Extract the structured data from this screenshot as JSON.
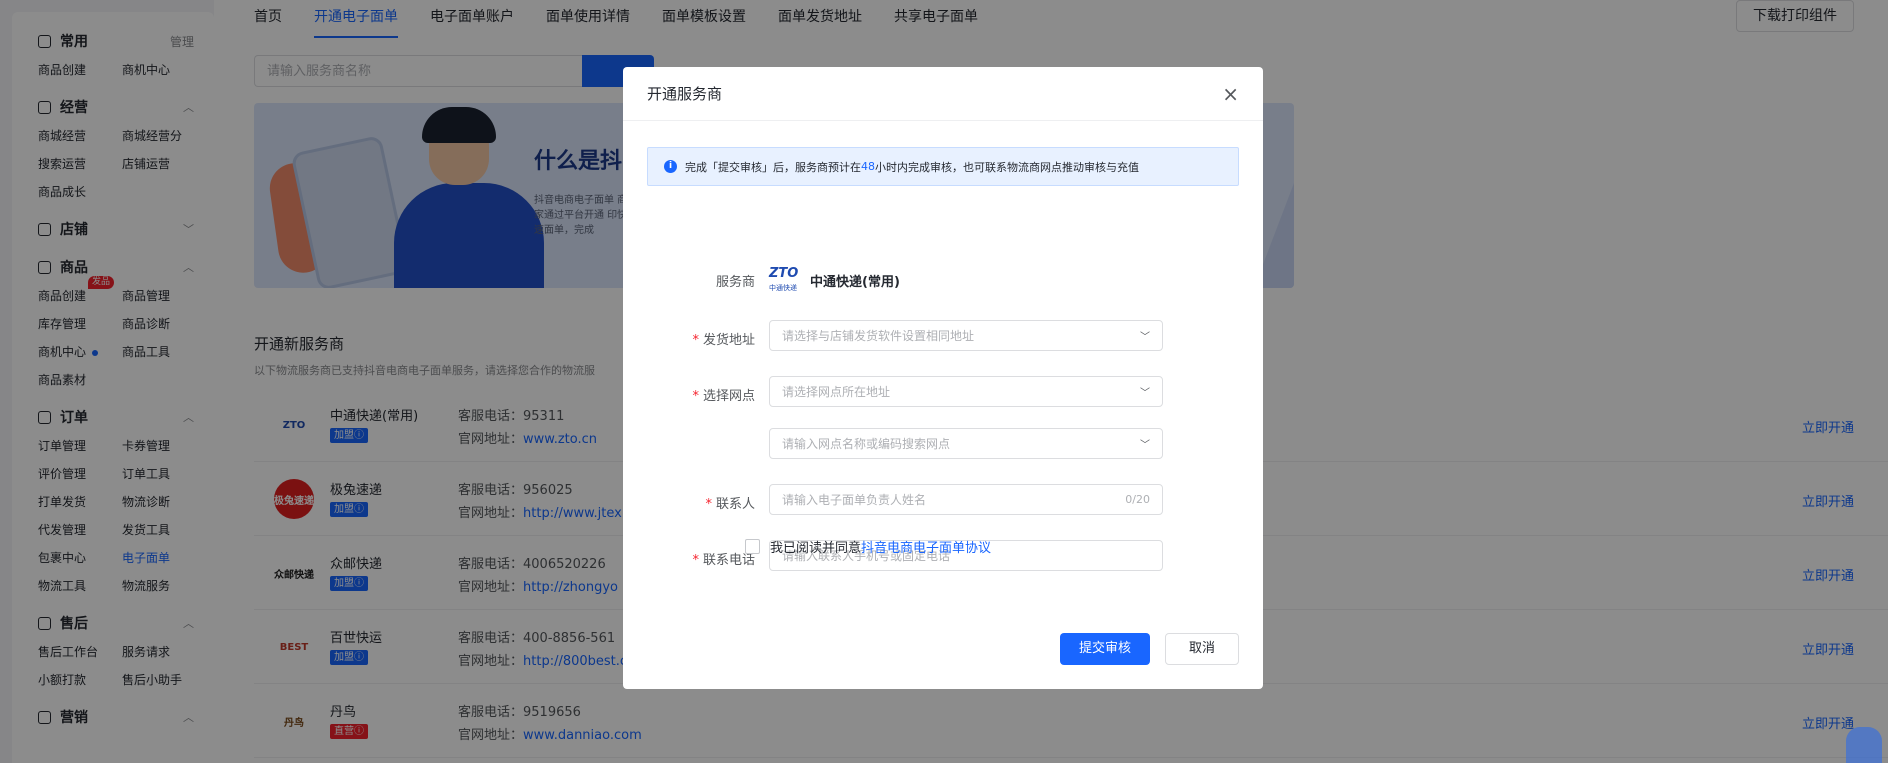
{
  "sidebar": {
    "groups": [
      {
        "title": "常用",
        "action": "管理",
        "items": [
          "商品创建",
          "商机中心"
        ]
      },
      {
        "title": "经营",
        "items": [
          "商城经营",
          "商城经营分",
          "搜索运营",
          "店铺运营",
          "商品成长"
        ]
      },
      {
        "title": "店铺",
        "items": []
      },
      {
        "title": "商品",
        "badge": "发品",
        "items": [
          "商品创建",
          "商品管理",
          "库存管理",
          "商品诊断",
          "商机中心",
          "商品工具",
          "商品素材"
        ]
      },
      {
        "title": "订单",
        "items": [
          "订单管理",
          "卡券管理",
          "评价管理",
          "订单工具",
          "打单发货",
          "物流诊断",
          "代发管理",
          "发货工具",
          "包裹中心",
          "电子面单",
          "物流工具",
          "物流服务"
        ]
      },
      {
        "title": "售后",
        "items": [
          "售后工作台",
          "服务请求",
          "小额打款",
          "售后小助手"
        ]
      },
      {
        "title": "营销",
        "items": []
      }
    ]
  },
  "tabs": [
    "首页",
    "开通电子面单",
    "电子面单账户",
    "面单使用详情",
    "面单模板设置",
    "面单发货地址",
    "共享电子面单"
  ],
  "download_label": "下载打印组件",
  "search": {
    "placeholder": "请输入服务商名称"
  },
  "banner": {
    "title": "什么是抖",
    "desc": "抖音电商电子面单 商家通过平台开通 印快速面单，完成"
  },
  "section": {
    "title": "开通新服务商",
    "desc": "以下物流服务商已支持抖音电商电子面单服务，请选择您合作的物流服"
  },
  "carriers": [
    {
      "name": "中通快递(常用)",
      "tag": "加盟ⓘ",
      "tel_label": "客服电话：",
      "tel": "95311",
      "web_label": "官网地址：",
      "web": "www.zto.cn",
      "open": "立即开通",
      "logo": "ZTO",
      "logo_sub": "中通快递"
    },
    {
      "name": "极兔速递",
      "tag": "加盟ⓘ",
      "tel_label": "客服电话：",
      "tel": "956025",
      "web_label": "官网地址：",
      "web": "http://www.jtex",
      "open": "立即开通",
      "logo": "极兔速递"
    },
    {
      "name": "众邮快递",
      "tag": "加盟ⓘ",
      "tel_label": "客服电话：",
      "tel": "4006520226",
      "web_label": "官网地址：",
      "web": "http://zhongyo",
      "open": "立即开通",
      "logo": "众邮快递"
    },
    {
      "name": "百世快运",
      "tag": "加盟ⓘ",
      "tel_label": "客服电话：",
      "tel": "400-8856-561",
      "web_label": "官网地址：",
      "web": "http://800best.c",
      "open": "立即开通",
      "logo": "BEST"
    },
    {
      "name": "丹鸟",
      "tag": "直营ⓘ",
      "tel_label": "客服电话：",
      "tel": "9519656",
      "web_label": "官网地址：",
      "web": "www.danniao.com",
      "open": "立即开通",
      "logo": "丹鸟"
    }
  ],
  "modal": {
    "title": "开通服务商",
    "close": "×",
    "notice_pre": "完成「提交审核」后，服务商预计在 ",
    "notice_hours": "48",
    "notice_post": " 小时内完成审核，也可联系物流商网点推动审核与充值",
    "provider_label": "服务商",
    "provider_logo": "ZTO",
    "provider_logo_sub": "中通快递",
    "provider_name": "中通快递(常用)",
    "address_label": "发货地址",
    "address_placeholder": "请选择与店铺发货软件设置相同地址",
    "branch_label": "选择网点",
    "branch_placeholder": "请选择网点所在地址",
    "branch_search_placeholder": "请输入网点名称或编码搜索网点",
    "contact_label": "联系人",
    "contact_placeholder": "请输入电子面单负责人姓名",
    "contact_count": "0/20",
    "phone_label": "联系电话",
    "phone_placeholder": "请输入联系人手机号或固定电话",
    "agree_text": "我已阅读并同意",
    "agree_link": "抖音电商电子面单协议",
    "submit": "提交审核",
    "cancel": "取消",
    "required_mark": "*"
  },
  "colors": {
    "accent": "#1966ff",
    "required": "#f5222d",
    "tag_join": "#1966ff",
    "tag_direct": "#f5222d"
  }
}
